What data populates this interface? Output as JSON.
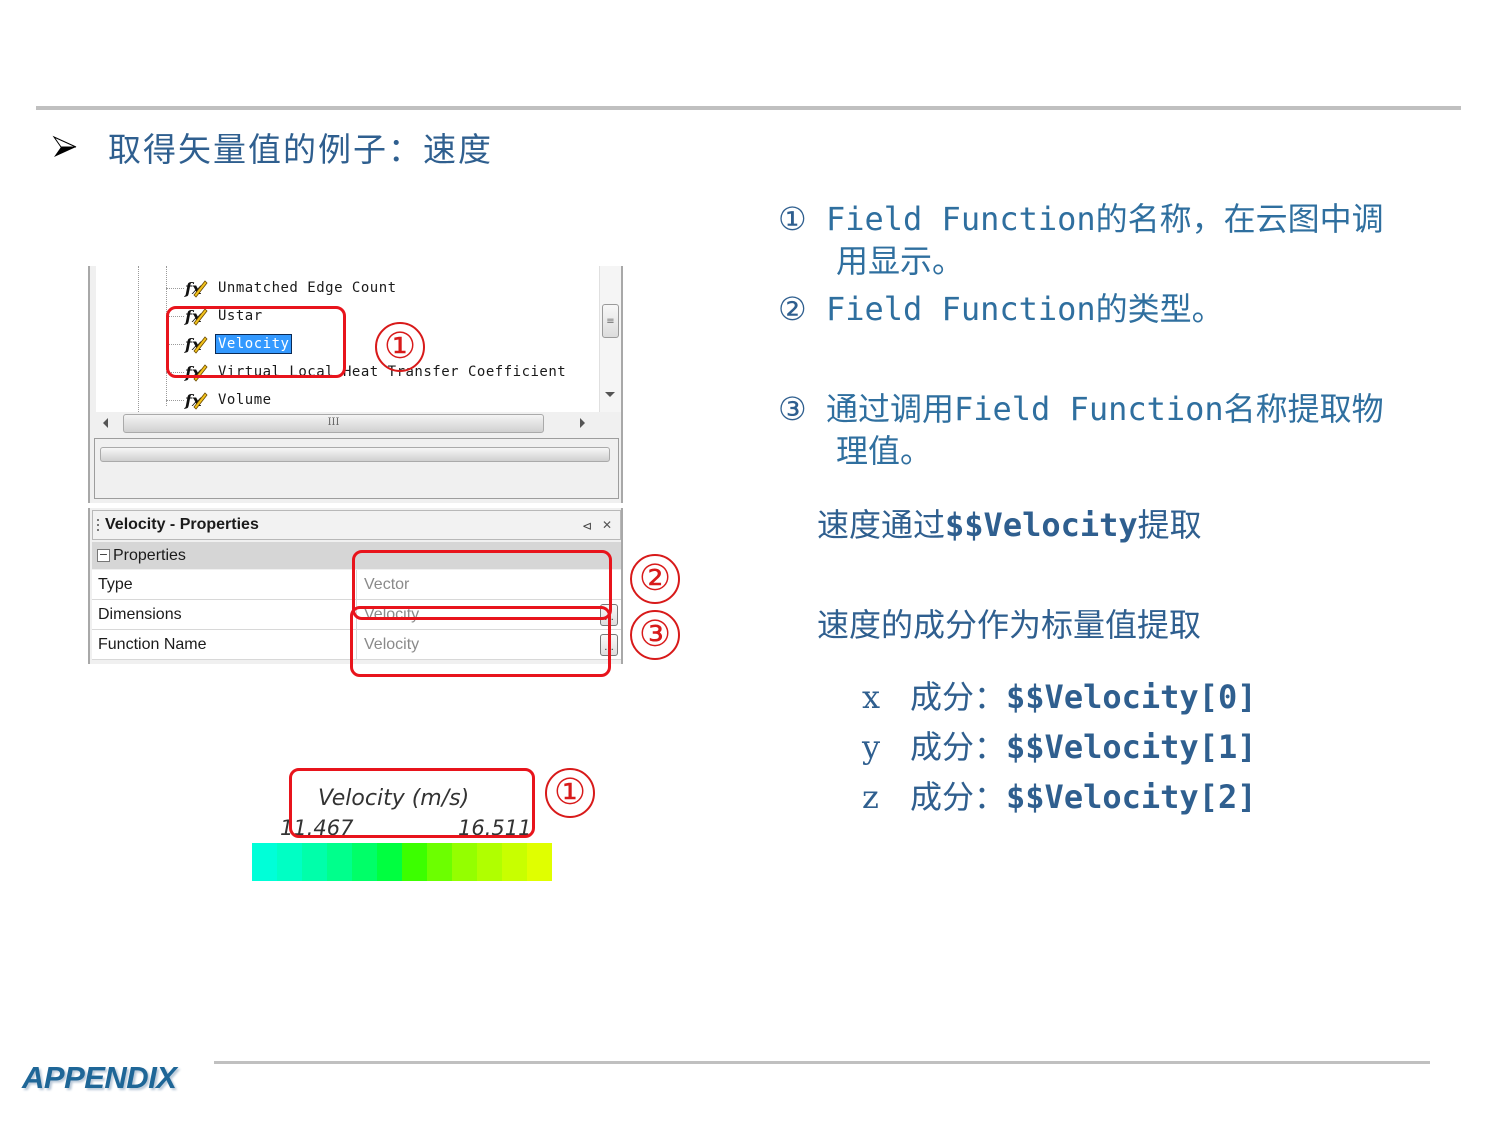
{
  "slide": {
    "heading": "取得矢量值的例子：速度",
    "footer_label": "APPENDIX"
  },
  "tree": {
    "items": [
      {
        "label": "Unmatched Edge Count",
        "icon": "field-function-icon",
        "selected": false
      },
      {
        "label": "Ustar",
        "icon": "field-function-icon",
        "selected": false
      },
      {
        "label": "Velocity",
        "icon": "field-function-icon",
        "selected": true
      },
      {
        "label": "Virtual Local Heat Transfer Coefficient",
        "icon": "field-function-icon",
        "selected": false
      },
      {
        "label": "Volume",
        "icon": "field-function-icon",
        "selected": false
      }
    ],
    "hscroll_grip": "III",
    "vscroll_grip": "≡"
  },
  "properties": {
    "title": "Velocity - Properties",
    "pin_icon": "⊲",
    "close_icon": "✕",
    "group_label": "Properties",
    "rows": [
      {
        "key": "Type",
        "value": "Vector",
        "has_button": false
      },
      {
        "key": "Dimensions",
        "value": "Velocity",
        "has_button": true
      },
      {
        "key": "Function Name",
        "value": "Velocity",
        "has_button": true
      }
    ],
    "button_label": "..."
  },
  "legend": {
    "title": "Velocity (m/s)",
    "min": "11.467",
    "max": "16.511",
    "colors": [
      "#00ffd8",
      "#00ffc4",
      "#00ffaa",
      "#00ff8c",
      "#00ff68",
      "#00ff40",
      "#3cff00",
      "#6cff00",
      "#94ff00",
      "#b0ff00",
      "#c8ff00",
      "#e0ff00"
    ]
  },
  "callouts": {
    "one": "①",
    "two": "②",
    "three": "③"
  },
  "explanations": [
    {
      "marker": "①",
      "line1": "Field Function的名称，在云图中调",
      "line2": "用显示。"
    },
    {
      "marker": "②",
      "line1": "Field Function的类型。",
      "line2": ""
    },
    {
      "marker": "③",
      "line1": "通过调用Field Function名称提取物",
      "line2": "理值。"
    }
  ],
  "notes": {
    "vector_prefix": "速度通过",
    "vector_code": "$$Velocity",
    "vector_suffix": "提取",
    "scalar_line": "速度的成分作为标量值提取"
  },
  "components": [
    {
      "axis": "x",
      "label": "成分：",
      "code": "$$Velocity[0]"
    },
    {
      "axis": "y",
      "label": "成分：",
      "code": "$$Velocity[1]"
    },
    {
      "axis": "z",
      "label": "成分：",
      "code": "$$Velocity[2]"
    }
  ],
  "colors": {
    "heading_text": "#2f5f8f",
    "callout_red": "#e8141c",
    "selection_blue": "#3399ff",
    "appendix_blue": "#1e6697"
  }
}
